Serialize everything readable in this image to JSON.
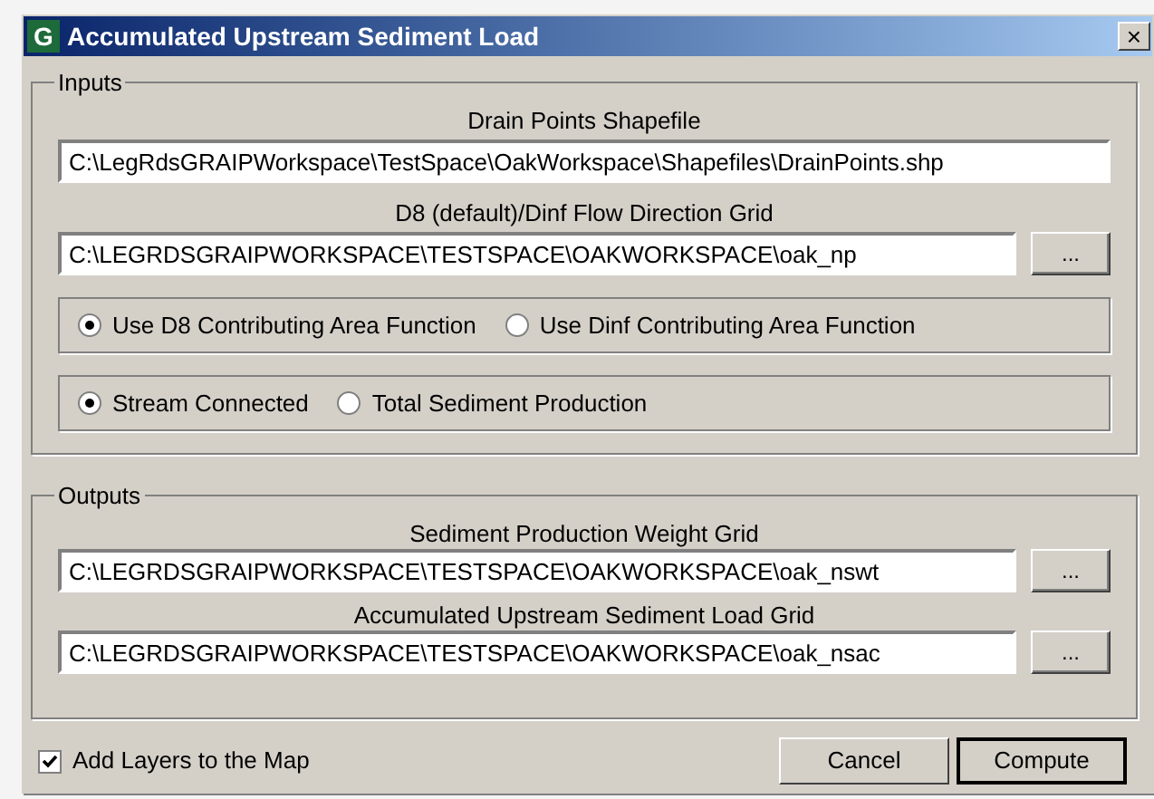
{
  "window": {
    "title": "Accumulated Upstream Sediment Load",
    "app_icon": "G",
    "close": "×"
  },
  "inputs": {
    "legend": "Inputs",
    "fields": [
      {
        "label": "Drain Points Shapefile",
        "value": "C:\\LegRdsGRAIPWorkspace\\TestSpace\\OakWorkspace\\Shapefiles\\DrainPoints.shp"
      },
      {
        "label": "D8 (default)/Dinf Flow Direction Grid",
        "value": "C:\\LEGRDSGRAIPWORKSPACE\\TESTSPACE\\OAKWORKSPACE\\oak_np",
        "browse": "..."
      }
    ],
    "radio_groups": [
      [
        {
          "label": "Use D8 Contributing Area Function",
          "selected": true
        },
        {
          "label": "Use Dinf Contributing Area Function",
          "selected": false
        }
      ],
      [
        {
          "label": "Stream Connected",
          "selected": true
        },
        {
          "label": "Total Sediment Production",
          "selected": false
        }
      ]
    ]
  },
  "outputs": {
    "legend": "Outputs",
    "fields": [
      {
        "label": "Sediment Production Weight Grid",
        "value": "C:\\LEGRDSGRAIPWORKSPACE\\TESTSPACE\\OAKWORKSPACE\\oak_nswt",
        "browse": "..."
      },
      {
        "label": "Accumulated Upstream Sediment Load Grid",
        "value": "C:\\LEGRDSGRAIPWORKSPACE\\TESTSPACE\\OAKWORKSPACE\\oak_nsac",
        "browse": "..."
      }
    ]
  },
  "add_layers": {
    "label": "Add Layers to the Map",
    "checked": true
  },
  "buttons": [
    {
      "label": "Cancel",
      "default": false
    },
    {
      "label": "Compute",
      "default": true
    }
  ]
}
